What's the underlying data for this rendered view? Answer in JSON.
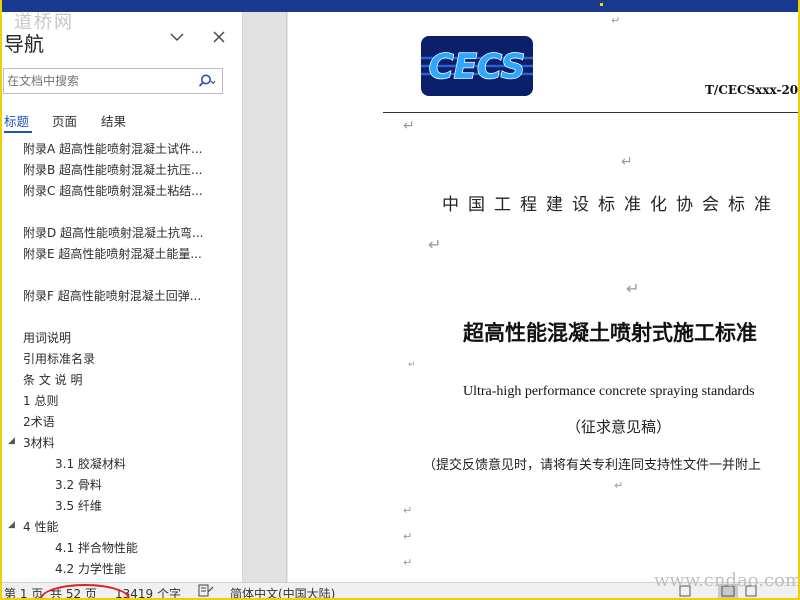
{
  "watermark_top_left": "道桥网",
  "nav": {
    "title": "导航",
    "search_placeholder": "在文档中搜索",
    "tabs": [
      "标题",
      "页面",
      "结果"
    ],
    "headings": [
      "附录A  超高性能喷射混凝土试件...",
      "附录B  超高性能喷射混凝土抗压...",
      "附录C  超高性能喷射混凝土粘结...",
      "附录D  超高性能喷射混凝土抗弯...",
      "附录E  超高性能喷射混凝土能量...",
      "附录F  超高性能喷射混凝土回弹...",
      "用词说明",
      "引用标准名录",
      "条 文 说 明",
      "1 总则",
      "2术语",
      "3材料",
      "3.1 胶凝材料",
      "3.2 骨料",
      "3.5 纤维",
      "4 性能",
      "4.1 拌合物性能",
      "4.2 力学性能"
    ]
  },
  "document": {
    "logo_text": "CECS",
    "code": "T/CECSxxx-20",
    "association": "中国工程建设标准化协会标准",
    "title_cn": "超高性能混凝土喷射式施工标准",
    "title_en": "Ultra-high performance concrete spraying standards",
    "draft": "（征求意见稿）",
    "note": "（提交反馈意见时，请将有关专利连同支持性文件一并附上",
    "para_mark": "↵"
  },
  "status_bar": {
    "page": "第 1 页",
    "total_pages": "共 52 页",
    "word_count": "13419 个字",
    "language": "简体中文(中国大陆)"
  },
  "watermark_bottom_right": "www.cndao.com",
  "colors": {
    "accent": "#1f53b8",
    "title_bar": "#1b3a8f",
    "frame": "#f0d000",
    "annotation": "#e02020"
  }
}
